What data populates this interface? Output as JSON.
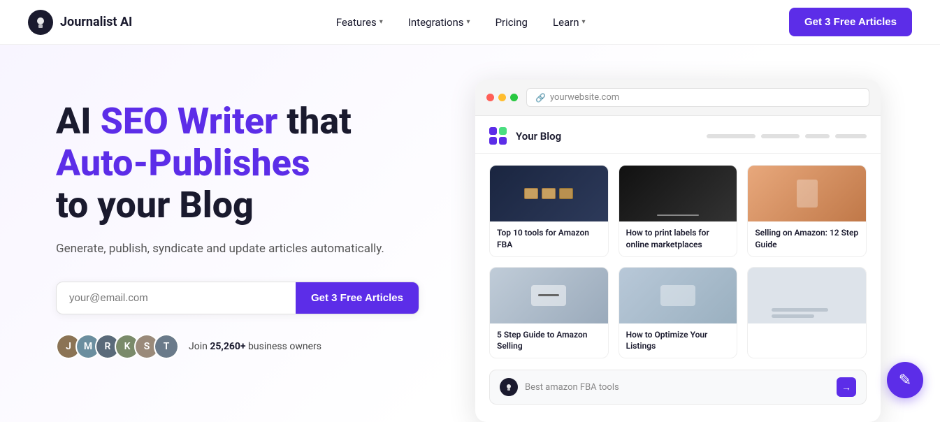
{
  "nav": {
    "logo_text": "Journalist AI",
    "links": [
      {
        "label": "Features",
        "has_dropdown": true
      },
      {
        "label": "Integrations",
        "has_dropdown": true
      },
      {
        "label": "Pricing",
        "has_dropdown": false
      },
      {
        "label": "Learn",
        "has_dropdown": true
      }
    ],
    "cta_label": "Get 3 Free Articles"
  },
  "hero": {
    "headline_plain": "AI ",
    "headline_purple": "SEO Writer",
    "headline_plain2": " that",
    "headline_line2": "Auto-Publishes",
    "headline_line3": "to your Blog",
    "subtext": "Generate, publish, syndicate and update articles automatically.",
    "email_placeholder": "your@email.com",
    "email_cta": "Get 3 Free Articles",
    "proof_text_pre": "Join ",
    "proof_count": "25,260+",
    "proof_text_post": " business owners"
  },
  "browser": {
    "url": "yourwebsite.com",
    "blog_title": "Your Blog",
    "nav_lines": [
      80,
      60,
      40,
      50
    ],
    "articles": [
      {
        "thumb_class": "thumb-1",
        "caption": "Top 10 tools for Amazon FBA"
      },
      {
        "thumb_class": "thumb-2",
        "caption": "How to print labels for online marketplaces"
      },
      {
        "thumb_class": "thumb-3",
        "caption": "Selling on Amazon: 12 Step Guide"
      },
      {
        "thumb_class": "thumb-4",
        "caption": "5 Step Guide to Amazon Selling"
      },
      {
        "thumb_class": "thumb-5",
        "caption": "How to Optimize Your Listings"
      },
      {
        "thumb_class": "thumb-6",
        "caption": ""
      }
    ],
    "chat_placeholder": "Best amazon FBA tools"
  },
  "avatars": [
    {
      "color": "#8b7355",
      "initial": "J"
    },
    {
      "color": "#6b8e9f",
      "initial": "M"
    },
    {
      "color": "#5a6a7a",
      "initial": "R"
    },
    {
      "color": "#7a8a6a",
      "initial": "K"
    },
    {
      "color": "#9a8a7a",
      "initial": "S"
    },
    {
      "color": "#6a7a8a",
      "initial": "T"
    }
  ]
}
